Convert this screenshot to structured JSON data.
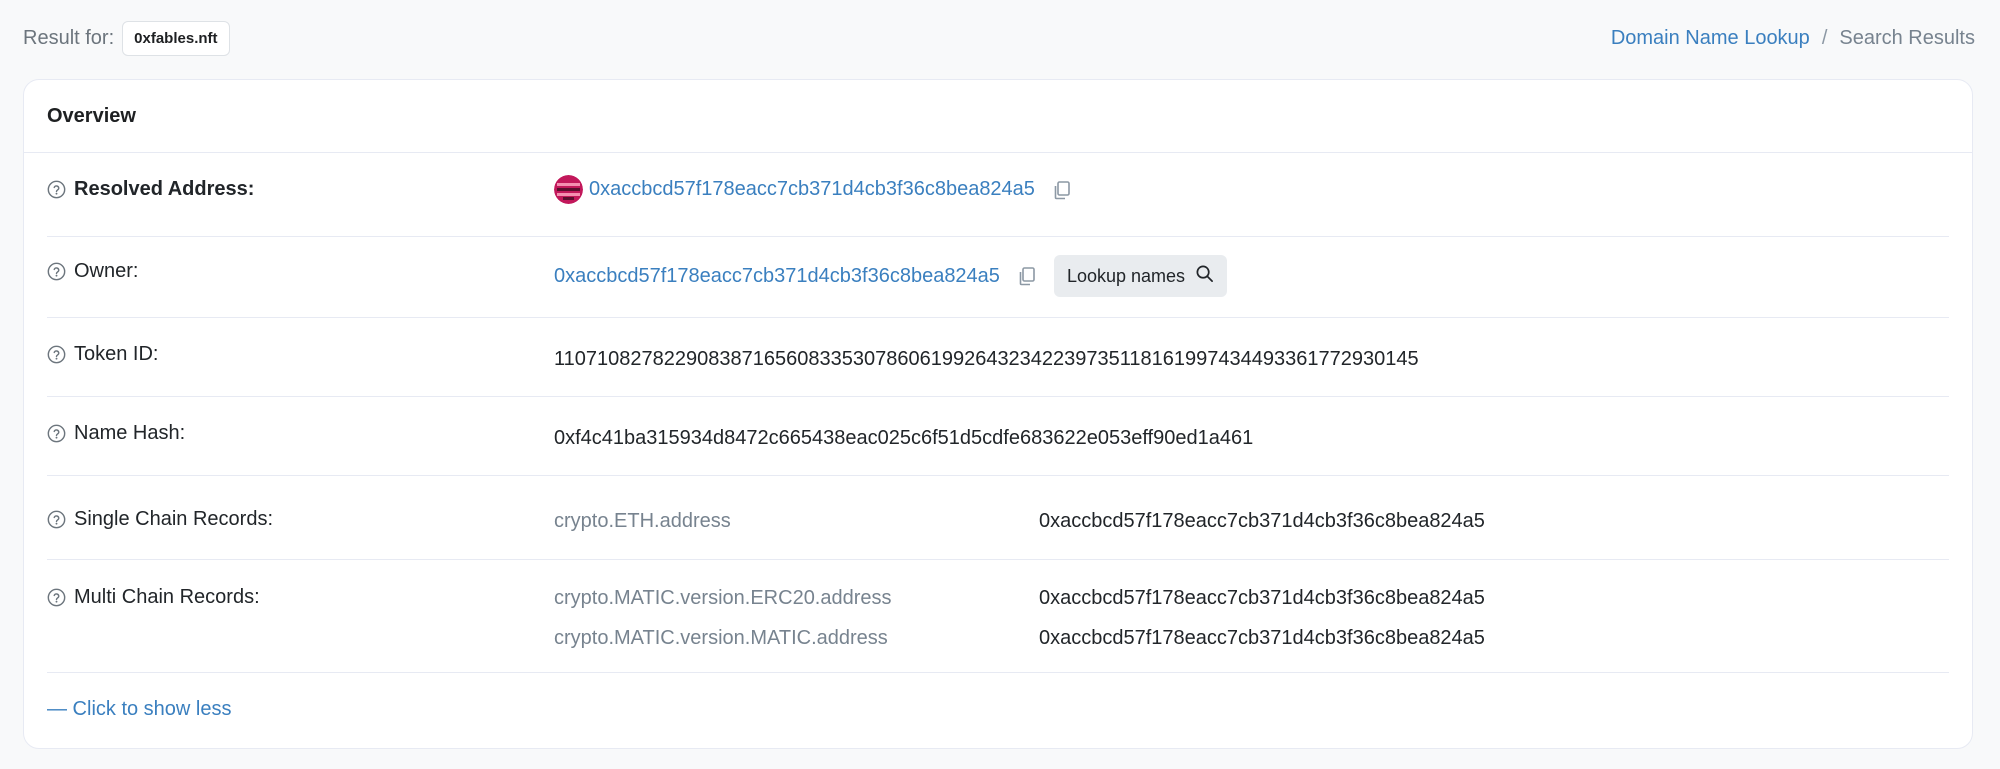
{
  "header": {
    "result_for_label": "Result for:",
    "domain": "0xfables.nft",
    "breadcrumb": {
      "link": "Domain Name Lookup",
      "separator": "/",
      "current": "Search Results"
    }
  },
  "card": {
    "title": "Overview",
    "rows": {
      "resolved": {
        "label": "Resolved Address:",
        "address": "0xaccbcd57f178eacc7cb371d4cb3f36c8bea824a5"
      },
      "owner": {
        "label": "Owner:",
        "address": "0xaccbcd57f178eacc7cb371d4cb3f36c8bea824a5",
        "lookup_button": "Lookup names"
      },
      "token": {
        "label": "Token ID:",
        "value": "110710827822908387165608335307860619926432342239735118161997434493361772930145"
      },
      "namehash": {
        "label": "Name Hash:",
        "value": "0xf4c41ba315934d8472c665438eac025c6f51d5cdfe683622e053eff90ed1a461"
      },
      "single_chain": {
        "label": "Single Chain Records:",
        "records": [
          {
            "key": "crypto.ETH.address",
            "value": "0xaccbcd57f178eacc7cb371d4cb3f36c8bea824a5"
          }
        ]
      },
      "multi_chain": {
        "label": "Multi Chain Records:",
        "records": [
          {
            "key": "crypto.MATIC.version.ERC20.address",
            "value": "0xaccbcd57f178eacc7cb371d4cb3f36c8bea824a5"
          },
          {
            "key": "crypto.MATIC.version.MATIC.address",
            "value": "0xaccbcd57f178eacc7cb371d4cb3f36c8bea824a5"
          }
        ]
      }
    },
    "show_less": "— Click to show less"
  },
  "colors": {
    "link": "#3a7fbf",
    "muted": "#77838f",
    "border": "#e7eaf3",
    "avatar_primary": "#c2185b",
    "avatar_dark": "#5a0f2e"
  },
  "icons": {
    "help": "question-circle-icon",
    "copy": "copy-icon",
    "search": "search-icon"
  }
}
